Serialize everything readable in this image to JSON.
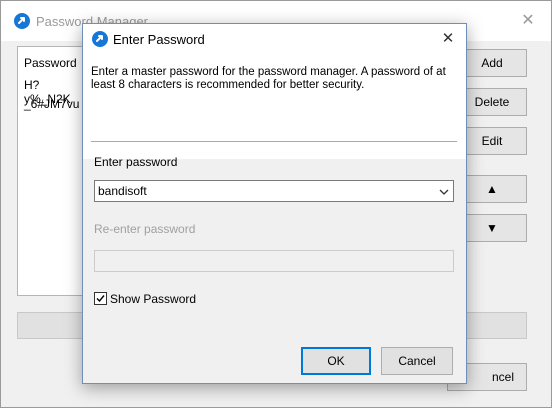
{
  "background_window": {
    "title": "Password Manager",
    "close_glyph": "✕",
    "list_header": "Password",
    "list_items": [
      "H?y%_N2K",
      "_6#JM7vu"
    ],
    "buttons": [
      "Add",
      "Delete",
      "Edit",
      "▲",
      "▼"
    ],
    "cancel_label_partial": "ncel"
  },
  "dialog": {
    "title": "Enter Password",
    "close_glyph": "✕",
    "description": "Enter a master password for the password manager. A password of at least 8 characters is recommended for better security.",
    "enter_label": "Enter password",
    "password_value": "bandisoft",
    "reenter_label": "Re-enter password",
    "reenter_value": "",
    "show_password_label": "Show Password",
    "show_password_checked": true,
    "ok_label": "OK",
    "cancel_label": "Cancel"
  },
  "icons": {
    "app": "app-logo-icon",
    "close": "close-icon",
    "chevron": "chevron-down-icon",
    "check": "checkmark-icon"
  },
  "colors": {
    "accent": "#0078d7",
    "app_icon": "#1677d6"
  }
}
